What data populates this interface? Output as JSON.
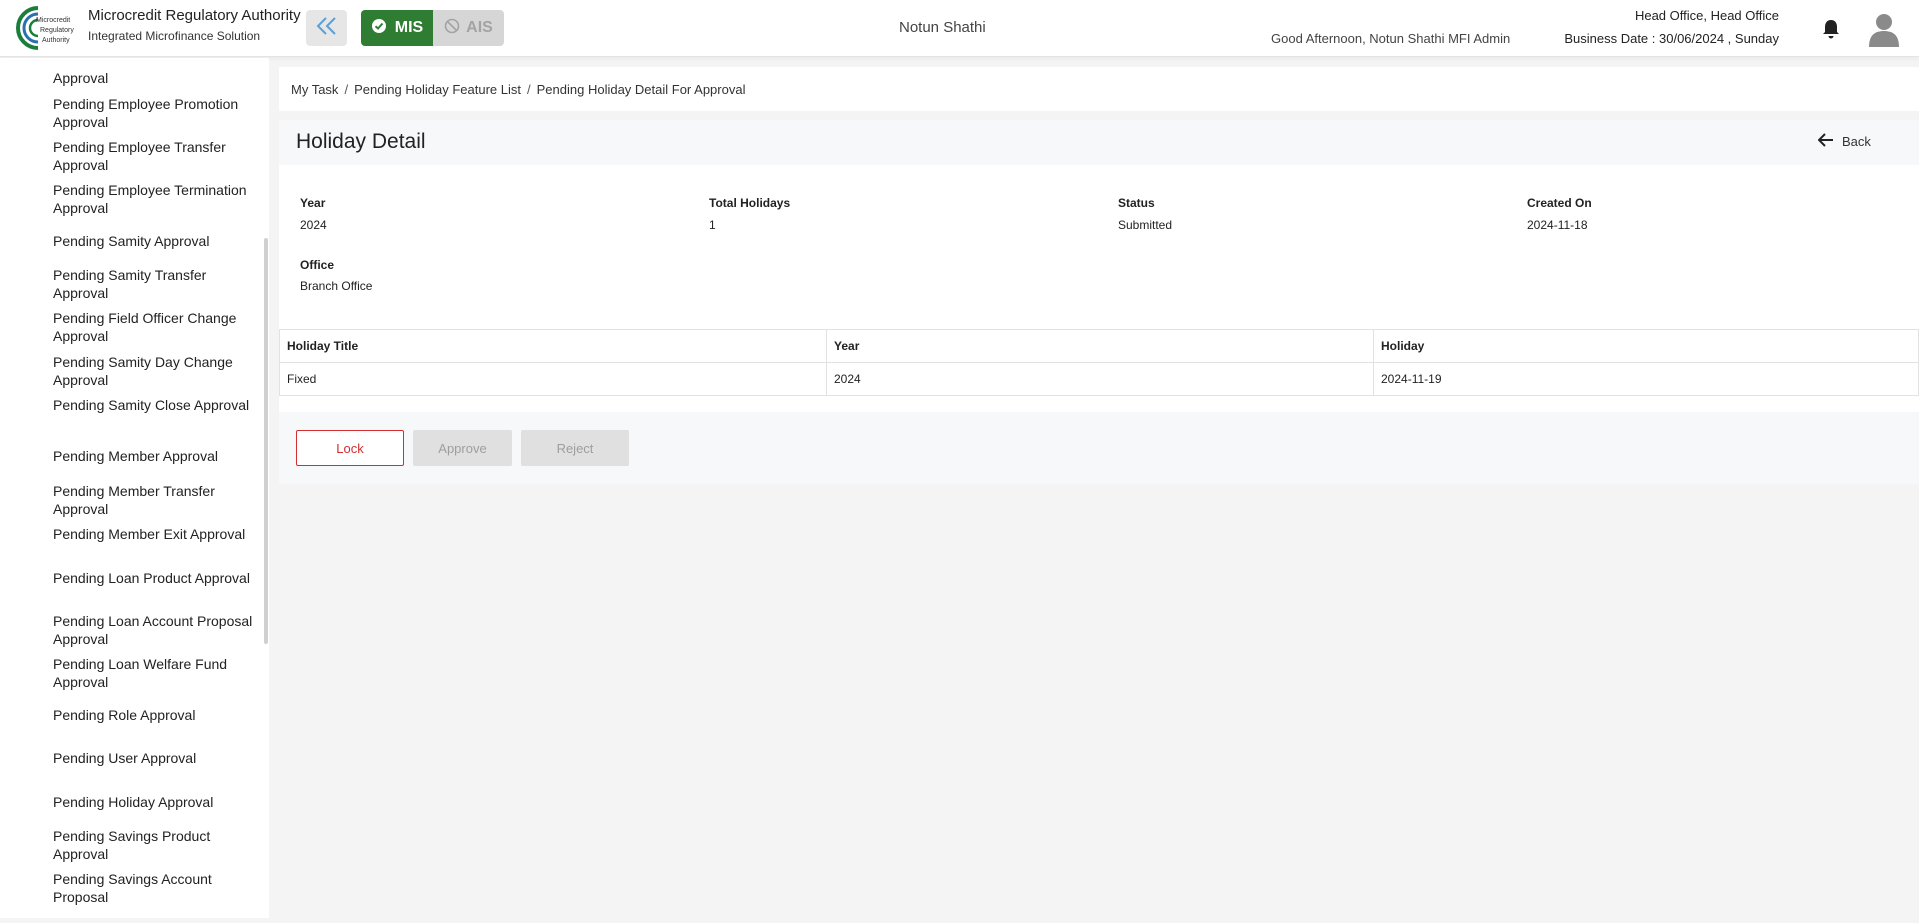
{
  "header": {
    "brand_title": "Microcredit Regulatory Authority",
    "brand_subtitle": "Integrated Microfinance Solution",
    "logo_text": "Microcredit Regulatory Authority",
    "mode_mis": "MIS",
    "mode_ais": "AIS",
    "org_name": "Notun Shathi",
    "greeting": "Good Afternoon, Notun Shathi MFI Admin",
    "office": "Head Office, Head Office",
    "business_date": "Business Date : 30/06/2024 , Sunday",
    "accent_color": "#2e7d32"
  },
  "sidebar": {
    "items": [
      "Approval",
      "Pending Employee Promotion Approval",
      "Pending Employee Transfer Approval",
      "Pending Employee Termination Approval",
      "Pending Samity Approval",
      "Pending Samity Transfer Approval",
      "Pending Field Officer Change Approval",
      "Pending Samity Day Change Approval",
      "Pending Samity Close Approval",
      "Pending Member Approval",
      "Pending Member Transfer Approval",
      "Pending Member Exit Approval",
      "Pending Loan Product Approval",
      "Pending Loan Account Proposal Approval",
      "Pending Loan Welfare Fund Approval",
      "Pending Role Approval",
      "Pending User Approval",
      "Pending Holiday Approval",
      "Pending Savings Product Approval",
      "Pending Savings Account Proposal"
    ]
  },
  "breadcrumb": {
    "items": [
      "My Task",
      "Pending Holiday Feature List",
      "Pending Holiday Detail For Approval"
    ],
    "separator": "/"
  },
  "detail": {
    "title": "Holiday Detail",
    "back_label": "Back",
    "fields": {
      "year_label": "Year",
      "year_value": "2024",
      "total_label": "Total Holidays",
      "total_value": "1",
      "status_label": "Status",
      "status_value": "Submitted",
      "created_label": "Created On",
      "created_value": "2024-11-18",
      "office_label": "Office",
      "office_value": "Branch Office"
    }
  },
  "table": {
    "headers": [
      "Holiday Title",
      "Year",
      "Holiday"
    ],
    "rows": [
      [
        "Fixed",
        "2024",
        "2024-11-19"
      ]
    ]
  },
  "actions": {
    "lock": "Lock",
    "approve": "Approve",
    "reject": "Reject"
  }
}
